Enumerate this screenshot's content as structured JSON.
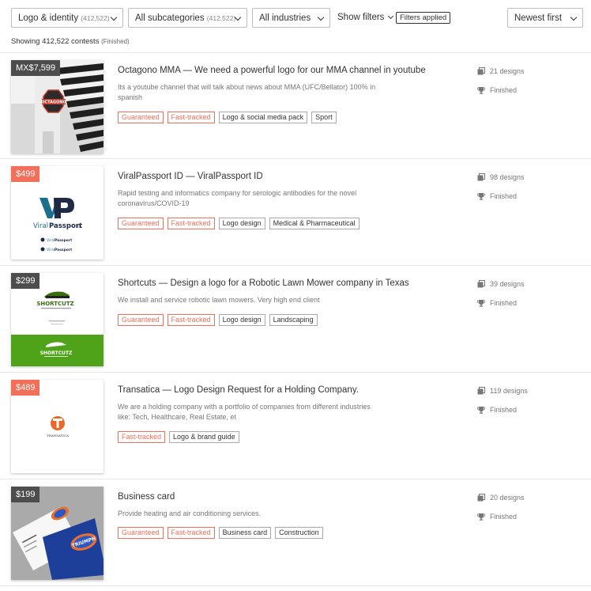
{
  "toolbar": {
    "category": {
      "label": "Logo & identity",
      "count": "(412,522)"
    },
    "subcategory": {
      "label": "All subcategories",
      "count": "(412,522)"
    },
    "industry": {
      "label": "All industries"
    },
    "show_filters": "Show filters",
    "filters_applied": "Filters applied",
    "sort": {
      "label": "Newest first"
    }
  },
  "showing": {
    "text": "Showing 412,522 contests",
    "status": "(Finished)"
  },
  "colors": {
    "accent": "#f26f5a",
    "price_dark": "#4d4d4d",
    "price_coral": "#f26f5a"
  },
  "contests": [
    {
      "price": "MX$7,599",
      "title": "Octagono MMA — We need a powerful logo for our MMA channel in youtube",
      "description": "Its a youtube channel that will talk about news about MMA (UFC/Bellator) 100% in spanish",
      "tags": [
        "Guaranteed",
        "Fast-tracked",
        "Logo & social media pack",
        "Sport"
      ],
      "designs": "21 designs",
      "status": "Finished",
      "thumb_text": "OCTAGONO"
    },
    {
      "price": "$499",
      "title": "ViralPassport ID — ViralPassport ID",
      "description": "Rapid testing and informatics company for serologic antibodies for the novel coronavirus/COVID-19",
      "tags": [
        "Guaranteed",
        "Fast-tracked",
        "Logo design",
        "Medical & Pharmaceutical"
      ],
      "designs": "98 designs",
      "status": "Finished",
      "thumb_brand_a": "Viral",
      "thumb_brand_b": "Passport",
      "thumb_brand_c": "ID"
    },
    {
      "price": "$299",
      "title": "Shortcuts — Design a logo for a Robotic Lawn Mower company in Texas",
      "description": "We install and service robotic lawn mowers. Very high end client",
      "tags": [
        "Guaranteed",
        "Fast-tracked",
        "Logo design",
        "Landscaping"
      ],
      "designs": "39 designs",
      "status": "Finished",
      "thumb_text": "SHORTCUTZ"
    },
    {
      "price": "$489",
      "title": "Transatica — Logo Design Request for a Holding Company.",
      "description": "We are a holding company with a portfolio of companies from different industries like: Tech, Healthcare, Real Estate, et",
      "tags": [
        "Fast-tracked",
        "Logo & brand guide"
      ],
      "designs": "119 designs",
      "status": "Finished",
      "thumb_text": "TRANSATICA"
    },
    {
      "price": "$199",
      "title": "Business card",
      "description": "Provide heating and air conditioning services.",
      "tags": [
        "Guaranteed",
        "Fast-tracked",
        "Business card",
        "Construction"
      ],
      "designs": "20 designs",
      "status": "Finished",
      "thumb_text": "TRIUMPH"
    }
  ]
}
